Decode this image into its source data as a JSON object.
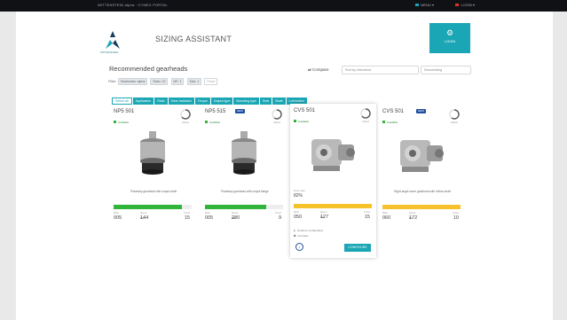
{
  "topbar": {
    "left_text": "WITTENSTEIN alpha · CYMEX PORTAL",
    "right_menu_1": "MENU",
    "right_menu_2": "LOGIN"
  },
  "header": {
    "brand": "WITTENSTEIN",
    "title": "SIZING ASSISTANT",
    "login_label": "LOGIN"
  },
  "main": {
    "title": "Recommended gearheads",
    "compare_label": "Compare",
    "select_1": "Sort by relevance",
    "select_2": "Descending",
    "filter_label": "Filter:",
    "filter_chips": [
      "Gearheads: alpha",
      "Ratio: 10",
      "MF: 1",
      "Size: 1",
      "Reset"
    ],
    "tabs": [
      {
        "label": "Select all",
        "active": true
      },
      {
        "label": "Application",
        "active": false
      },
      {
        "label": "Ratio",
        "active": false
      },
      {
        "label": "Gear backlash",
        "active": false
      },
      {
        "label": "Torque",
        "active": false
      },
      {
        "label": "Output type",
        "active": false
      },
      {
        "label": "Mounting type",
        "active": false
      },
      {
        "label": "Seal",
        "active": false
      },
      {
        "label": "Shaft",
        "active": false
      },
      {
        "label": "Lubrication",
        "active": false
      }
    ]
  },
  "cards": [
    {
      "name": "NP5 501",
      "sub": "",
      "status": "Available",
      "new": "",
      "gauge_label": "Utilized",
      "description": "Planetary gearhead with output shaft",
      "bar_color": "#31b43a",
      "bar_pct": 0.88,
      "m1_label": "Ratio",
      "m1": "005",
      "m2_label": "Speed",
      "m2": "144",
      "m2_unit": "Nm",
      "m3_label": "Travel",
      "m3": "15",
      "extra1": "",
      "extra2": "",
      "info": "",
      "confirm": ""
    },
    {
      "name": "NP5 515",
      "sub": "",
      "status": "Available",
      "new": "NEW",
      "gauge_label": "Utilized",
      "description": "Planetary gearhead with output flange",
      "bar_color": "#31b43a",
      "bar_pct": 0.78,
      "m1_label": "Ratio",
      "m1": "005",
      "m2_label": "Speed",
      "m2": "280",
      "m2_unit": "Nm",
      "m3_label": "Travel",
      "m3": "9",
      "extra1": "",
      "extra2": "",
      "info": "",
      "confirm": ""
    },
    {
      "name": "CVS 501",
      "sub": "",
      "status": "Available",
      "new": "",
      "gauge_label": "Utilized",
      "description": "",
      "bar_color": "#f6c12a",
      "bar_pct": 1.0,
      "m1_label": "Ratio",
      "m1": "050",
      "m2_label": "Speed",
      "m2": "127",
      "m2_unit": "Nm",
      "m3_label": "Travel",
      "m3": "15",
      "extra1": "Gearbox configuration",
      "extra2": "Compare",
      "info": "i",
      "confirm": "CONFIGURE",
      "bar_label": "Duty ratio",
      "bar_value": "82%"
    },
    {
      "name": "CVS 501",
      "sub": "",
      "status": "Available",
      "new": "NEW",
      "gauge_label": "Utilized",
      "description": "Right-angle worm gearhead with hollow shaft",
      "bar_color": "#f6c12a",
      "bar_pct": 1.0,
      "m1_label": "Ratio",
      "m1": "060",
      "m2_label": "Speed",
      "m2": "172",
      "m2_unit": "Nm",
      "m3_label": "Travel",
      "m3": "10",
      "extra1": "",
      "extra2": "",
      "info": "",
      "confirm": ""
    }
  ],
  "colors": {
    "accent": "#1aa6b4",
    "green": "#31b43a",
    "yellow": "#f6c12a",
    "badge": "#1f4f9e"
  }
}
